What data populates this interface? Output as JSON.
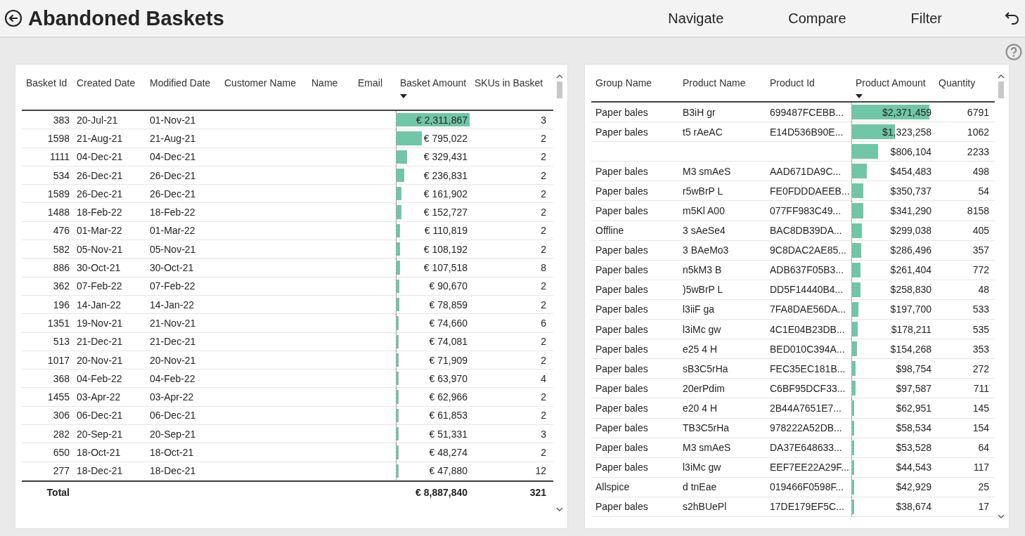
{
  "header": {
    "title": "Abandoned Baskets",
    "nav": [
      "Navigate",
      "Compare",
      "Filter"
    ]
  },
  "baskets": {
    "columns": [
      {
        "label": "Basket Id",
        "kind": "number",
        "sorted": false
      },
      {
        "label": "Created Date",
        "kind": "text",
        "sorted": false
      },
      {
        "label": "Modified Date",
        "kind": "text",
        "sorted": false
      },
      {
        "label": "Customer Name",
        "kind": "text",
        "sorted": false
      },
      {
        "label": "Name",
        "kind": "text",
        "sorted": false
      },
      {
        "label": "Email",
        "kind": "text",
        "sorted": false
      },
      {
        "label": "Basket Amount",
        "kind": "bar",
        "sorted": true
      },
      {
        "label": "SKUs in Basket",
        "kind": "number",
        "sorted": false
      }
    ],
    "rows": [
      {
        "basket_id": "383",
        "created_date": "20-Jul-21",
        "modified_date": "01-Nov-21",
        "basket_amount": "€ 2,311,867",
        "level": 1,
        "skus": "3"
      },
      {
        "basket_id": "1598",
        "created_date": "21-Aug-21",
        "modified_date": "21-Aug-21",
        "basket_amount": "€ 795,022",
        "level": 0.344,
        "skus": "2"
      },
      {
        "basket_id": "1111",
        "created_date": "04-Dec-21",
        "modified_date": "04-Dec-21",
        "basket_amount": "€ 329,431",
        "level": 0.142,
        "skus": "2"
      },
      {
        "basket_id": "534",
        "created_date": "26-Dec-21",
        "modified_date": "26-Dec-21",
        "basket_amount": "€ 236,831",
        "level": 0.102,
        "skus": "2"
      },
      {
        "basket_id": "1589",
        "created_date": "26-Dec-21",
        "modified_date": "26-Dec-21",
        "basket_amount": "€ 161,902",
        "level": 0.07,
        "skus": "2"
      },
      {
        "basket_id": "1488",
        "created_date": "18-Feb-22",
        "modified_date": "18-Feb-22",
        "basket_amount": "€ 152,727",
        "level": 0.066,
        "skus": "2"
      },
      {
        "basket_id": "476",
        "created_date": "01-Mar-22",
        "modified_date": "01-Mar-22",
        "basket_amount": "€ 110,819",
        "level": 0.048,
        "skus": "2"
      },
      {
        "basket_id": "582",
        "created_date": "05-Nov-21",
        "modified_date": "05-Nov-21",
        "basket_amount": "€ 108,192",
        "level": 0.047,
        "skus": "2"
      },
      {
        "basket_id": "886",
        "created_date": "30-Oct-21",
        "modified_date": "30-Oct-21",
        "basket_amount": "€ 107,518",
        "level": 0.047,
        "skus": "8"
      },
      {
        "basket_id": "362",
        "created_date": "07-Feb-22",
        "modified_date": "07-Feb-22",
        "basket_amount": "€ 90,670",
        "level": 0.039,
        "skus": "2"
      },
      {
        "basket_id": "196",
        "created_date": "14-Jan-22",
        "modified_date": "14-Jan-22",
        "basket_amount": "€ 78,859",
        "level": 0.034,
        "skus": "2"
      },
      {
        "basket_id": "1351",
        "created_date": "19-Nov-21",
        "modified_date": "21-Nov-21",
        "basket_amount": "€ 74,660",
        "level": 0.032,
        "skus": "6"
      },
      {
        "basket_id": "513",
        "created_date": "21-Dec-21",
        "modified_date": "21-Dec-21",
        "basket_amount": "€ 74,081",
        "level": 0.032,
        "skus": "2"
      },
      {
        "basket_id": "1017",
        "created_date": "20-Nov-21",
        "modified_date": "20-Nov-21",
        "basket_amount": "€ 71,909",
        "level": 0.031,
        "skus": "2"
      },
      {
        "basket_id": "368",
        "created_date": "04-Feb-22",
        "modified_date": "04-Feb-22",
        "basket_amount": "€ 63,970",
        "level": 0.028,
        "skus": "4"
      },
      {
        "basket_id": "1455",
        "created_date": "03-Apr-22",
        "modified_date": "03-Apr-22",
        "basket_amount": "€ 62,966",
        "level": 0.027,
        "skus": "2"
      },
      {
        "basket_id": "306",
        "created_date": "06-Dec-21",
        "modified_date": "06-Dec-21",
        "basket_amount": "€ 61,853",
        "level": 0.027,
        "skus": "2"
      },
      {
        "basket_id": "282",
        "created_date": "20-Sep-21",
        "modified_date": "20-Sep-21",
        "basket_amount": "€ 51,331",
        "level": 0.022,
        "skus": "3"
      },
      {
        "basket_id": "650",
        "created_date": "18-Oct-21",
        "modified_date": "18-Oct-21",
        "basket_amount": "€ 48,274",
        "level": 0.021,
        "skus": "2"
      },
      {
        "basket_id": "277",
        "created_date": "18-Dec-21",
        "modified_date": "18-Dec-21",
        "basket_amount": "€ 47,880",
        "level": 0.021,
        "skus": "12"
      }
    ],
    "total": {
      "basket_id": "Total",
      "basket_amount": "€ 8,887,840",
      "skus": "321"
    }
  },
  "products": {
    "columns": [
      {
        "label": "Group Name",
        "kind": "text",
        "sorted": false
      },
      {
        "label": "Product Name",
        "kind": "text",
        "sorted": false
      },
      {
        "label": "Product Id",
        "kind": "text",
        "sorted": false
      },
      {
        "label": "Product Amount",
        "kind": "bar",
        "sorted": true
      },
      {
        "label": "Quantity",
        "kind": "number",
        "sorted": false
      }
    ],
    "rows": [
      {
        "group_name": "Paper bales",
        "product_name": "B3iH  gr",
        "product_id": "699487FCEBB...",
        "product_amount": "$2,371,459",
        "level": 1,
        "quantity": "6791"
      },
      {
        "group_name": "Paper bales",
        "product_name": "t5 rAeAC",
        "product_id": "E14D536B90E...",
        "product_amount": "$1,323,258",
        "level": 0.558,
        "quantity": "1062"
      },
      {
        "product_amount": "$806,104",
        "level": 0.34,
        "quantity": "2233"
      },
      {
        "group_name": "Paper bales",
        "product_name": "M3 smAeS",
        "product_id": "AAD671DA9C...",
        "product_amount": "$454,483",
        "level": 0.192,
        "quantity": "498"
      },
      {
        "group_name": "Paper bales",
        "product_name": "r5wBrP L",
        "product_id": "FE0FDDDAEEB...",
        "product_amount": "$350,737",
        "level": 0.148,
        "quantity": "54"
      },
      {
        "group_name": "Paper bales",
        "product_name": "m5Kl A00",
        "product_id": "077FF983C49...",
        "product_amount": "$341,290",
        "level": 0.144,
        "quantity": "8158"
      },
      {
        "group_name": "Offline",
        "product_name": "3 sAeSe4",
        "product_id": "BAC8DB39DA...",
        "product_amount": "$299,038",
        "level": 0.126,
        "quantity": "405"
      },
      {
        "group_name": "Paper bales",
        "product_name": "3 BAeMo3",
        "product_id": "9C8DAC2AE85...",
        "product_amount": "$286,496",
        "level": 0.121,
        "quantity": "357"
      },
      {
        "group_name": "Paper bales",
        "product_name": "n5kM3 B",
        "product_id": "ADB637F05B3...",
        "product_amount": "$261,404",
        "level": 0.11,
        "quantity": "772"
      },
      {
        "group_name": "Paper bales",
        "product_name": ")5wBrP L",
        "product_id": "DD5F14440B4...",
        "product_amount": "$258,830",
        "level": 0.109,
        "quantity": "48"
      },
      {
        "group_name": "Paper bales",
        "product_name": "l3iiF ga",
        "product_id": "7FA8DAE56DA...",
        "product_amount": "$197,700",
        "level": 0.083,
        "quantity": "533"
      },
      {
        "group_name": "Paper bales",
        "product_name": "l3iMc gw",
        "product_id": "4C1E04B23DB...",
        "product_amount": "$178,211",
        "level": 0.075,
        "quantity": "535"
      },
      {
        "group_name": "Paper bales",
        "product_name": "e25  4 H",
        "product_id": "BED010C394A...",
        "product_amount": "$154,268",
        "level": 0.065,
        "quantity": "353"
      },
      {
        "group_name": "Paper bales",
        "product_name": "sB3C5rHa",
        "product_id": "FEC35EC181B...",
        "product_amount": "$98,754",
        "level": 0.042,
        "quantity": "272"
      },
      {
        "group_name": "Paper bales",
        "product_name": "20erPdim",
        "product_id": "C6BF95DCF33...",
        "product_amount": "$97,587",
        "level": 0.041,
        "quantity": "711"
      },
      {
        "group_name": "Paper bales",
        "product_name": "e20  4 H",
        "product_id": "2B44A7651E7...",
        "product_amount": "$62,951",
        "level": 0.027,
        "quantity": "145"
      },
      {
        "group_name": "Paper bales",
        "product_name": "TB3C5rHa",
        "product_id": "978222A52DB...",
        "product_amount": "$58,534",
        "level": 0.025,
        "quantity": "154"
      },
      {
        "group_name": "Paper bales",
        "product_name": "M3 smAeS",
        "product_id": "DA37E648633...",
        "product_amount": "$53,528",
        "level": 0.023,
        "quantity": "64"
      },
      {
        "group_name": "Paper bales",
        "product_name": "l3iMc gw",
        "product_id": "EEF7EE22A29F...",
        "product_amount": "$44,543",
        "level": 0.019,
        "quantity": "117"
      },
      {
        "group_name": "Allspice",
        "product_name": "d tnEae",
        "product_id": "019466F0598F...",
        "product_amount": "$42,929",
        "level": 0.018,
        "quantity": "25"
      },
      {
        "group_name": "Paper bales",
        "product_name": "s2hBUePl",
        "product_id": "17DE179EF5C...",
        "product_amount": "$38,674",
        "level": 0.016,
        "quantity": "17"
      }
    ]
  }
}
